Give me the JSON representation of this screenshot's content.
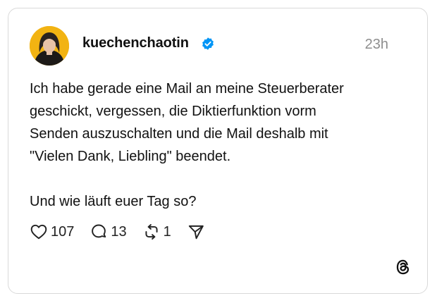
{
  "post": {
    "username": "kuechenchaotin",
    "verified": true,
    "timestamp": "23h",
    "text": "Ich habe gerade eine Mail an meine Steuerberater\ngeschickt, vergessen, die Diktierfunktion vorm\nSenden auszuschalten und die Mail deshalb mit\n\"Vielen Dank, Liebling\" beendet.\n\nUnd wie läuft euer Tag so?",
    "actions": {
      "likes": "107",
      "replies": "13",
      "reposts": "1"
    }
  },
  "icons": {
    "like": "heart-icon",
    "reply": "comment-icon",
    "repost": "repost-icon",
    "share": "send-icon",
    "brand": "threads-logo-icon",
    "verified": "verified-badge-icon"
  },
  "colors": {
    "verified_badge": "#0095f6",
    "avatar_background": "#f2b312",
    "timestamp": "#8e8e8e",
    "card_border": "#d9d9d9"
  }
}
